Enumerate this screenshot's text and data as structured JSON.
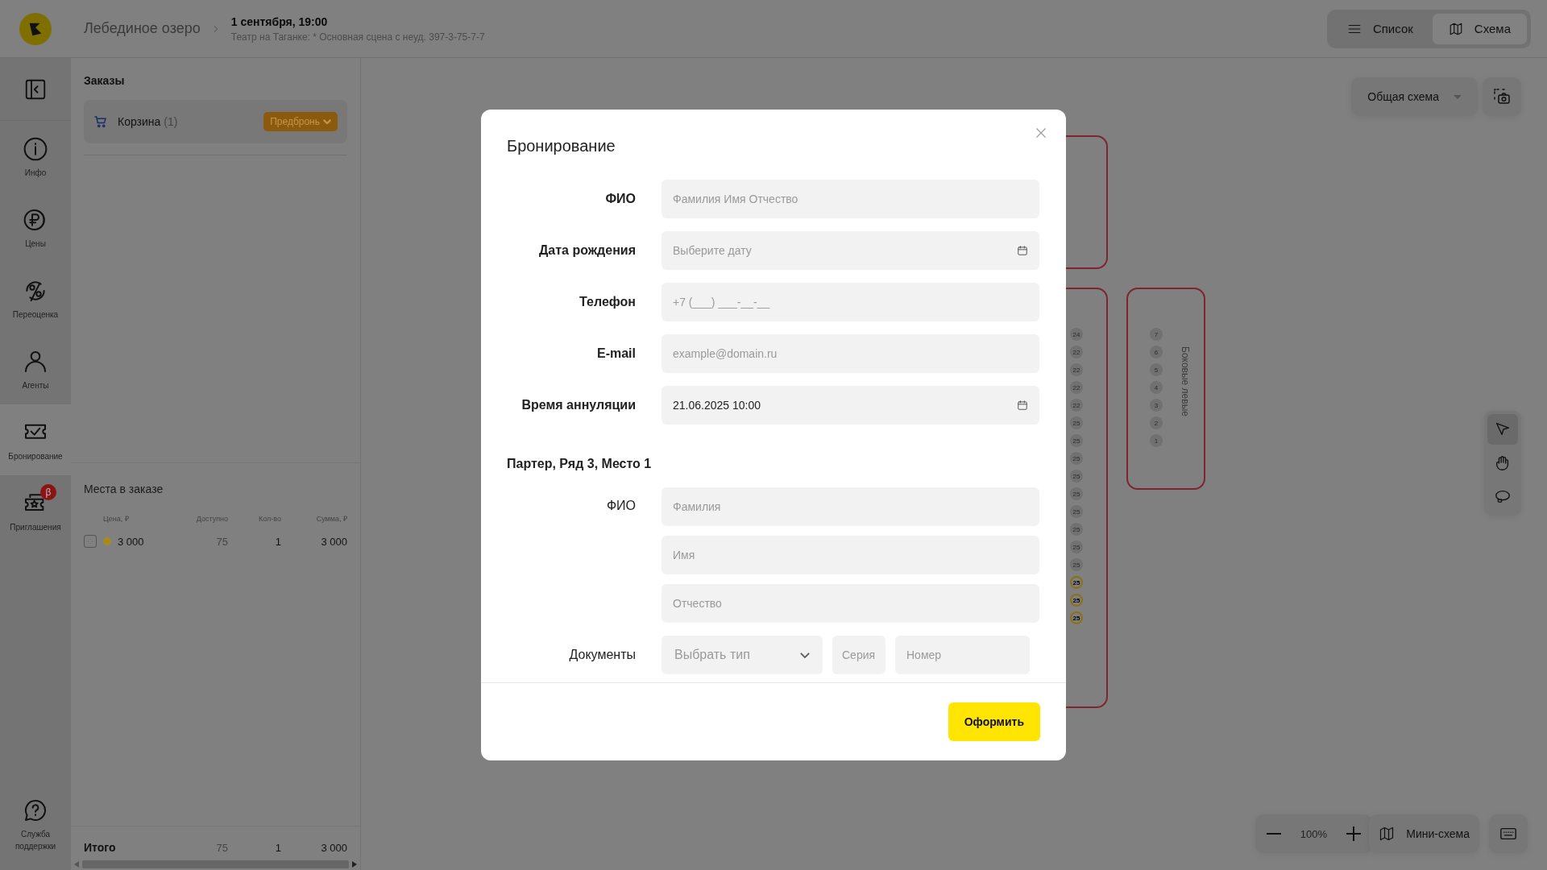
{
  "header": {
    "event": "Лебединое озеро",
    "date": "1 сентября, 19:00",
    "venue": "Театр на Таганке: * Основная сцена с неуд. 397-3-75-7-7"
  },
  "view_switch": [
    {
      "label": "Список",
      "selected": false
    },
    {
      "label": "Схема",
      "selected": true
    }
  ],
  "rail": {
    "items": [
      {
        "label": "Инфо",
        "selected": false
      },
      {
        "label": "Цены",
        "selected": false
      },
      {
        "label": "Переоценка",
        "selected": false
      },
      {
        "label": "Агенты",
        "selected": false
      },
      {
        "label": "Бронирование",
        "selected": true
      },
      {
        "label": "Приглашения",
        "selected": false,
        "badge": "β"
      }
    ],
    "support": "Служба поддержки"
  },
  "orders": {
    "title": "Заказы",
    "cart": {
      "label": "Корзина",
      "count": "(1)",
      "action": "Предбронь"
    }
  },
  "seats_in_order": {
    "title": "Места в заказе",
    "columns": [
      "Цена, ₽",
      "Доступно",
      "Кол-во",
      "Сумма, ₽"
    ],
    "rows": [
      {
        "checked": false,
        "color": "#a88a1c",
        "price": "3 000",
        "available": "75",
        "qty": "1",
        "sum": "3 000"
      }
    ],
    "total": {
      "label": "Итого",
      "available": "75",
      "qty": "1",
      "sum": "3 000"
    }
  },
  "map": {
    "scheme_select": "Общая схема",
    "section_label": "Боковые левые",
    "main_seats": [
      {
        "n": "24",
        "selected": false
      },
      {
        "n": "22",
        "selected": false
      },
      {
        "n": "22",
        "selected": false
      },
      {
        "n": "22",
        "selected": false
      },
      {
        "n": "22",
        "selected": false
      },
      {
        "n": "25",
        "selected": false
      },
      {
        "n": "25",
        "selected": false
      },
      {
        "n": "25",
        "selected": false
      },
      {
        "n": "25",
        "selected": false
      },
      {
        "n": "25",
        "selected": false
      },
      {
        "n": "25",
        "selected": false
      },
      {
        "n": "25",
        "selected": false
      },
      {
        "n": "25",
        "selected": false
      },
      {
        "n": "25",
        "selected": false
      },
      {
        "n": "25",
        "selected": true
      },
      {
        "n": "25",
        "selected": true
      },
      {
        "n": "25",
        "selected": true
      }
    ],
    "side_seats": [
      {
        "n": "7",
        "selected": false
      },
      {
        "n": "6",
        "selected": false
      },
      {
        "n": "5",
        "selected": false
      },
      {
        "n": "4",
        "selected": false
      },
      {
        "n": "3",
        "selected": false
      },
      {
        "n": "2",
        "selected": false
      },
      {
        "n": "1",
        "selected": false
      }
    ],
    "tools": [
      {
        "selected": true
      },
      {
        "selected": false
      },
      {
        "selected": false
      }
    ],
    "zoom": "100%",
    "minimap": "Мини-схема"
  },
  "dialog": {
    "title": "Бронирование",
    "fields": [
      {
        "label": "ФИО",
        "kind": "text",
        "placeholder": "Фамилия Имя Отчество"
      },
      {
        "label": "Дата рождения",
        "kind": "date",
        "placeholder": "Выберите дату"
      },
      {
        "label": "Телефон",
        "kind": "text",
        "placeholder": "+7 (___) ___-__-__"
      },
      {
        "label": "E-mail",
        "kind": "text",
        "placeholder": "example@domain.ru"
      },
      {
        "label": "Время аннуляции",
        "kind": "date",
        "value": "21.06.2025 10:00"
      }
    ],
    "seat_title": "Партер, Ряд 3, Место 1",
    "seat_fields": {
      "label": "ФИО",
      "inputs": [
        {
          "placeholder": "Фамилия"
        },
        {
          "placeholder": "Имя"
        },
        {
          "placeholder": "Отчество"
        }
      ]
    },
    "documents": {
      "label": "Документы",
      "type_placeholder": "Выбрать тип",
      "series_placeholder": "Серия",
      "number_placeholder": "Номер"
    },
    "submit": "Оформить"
  }
}
